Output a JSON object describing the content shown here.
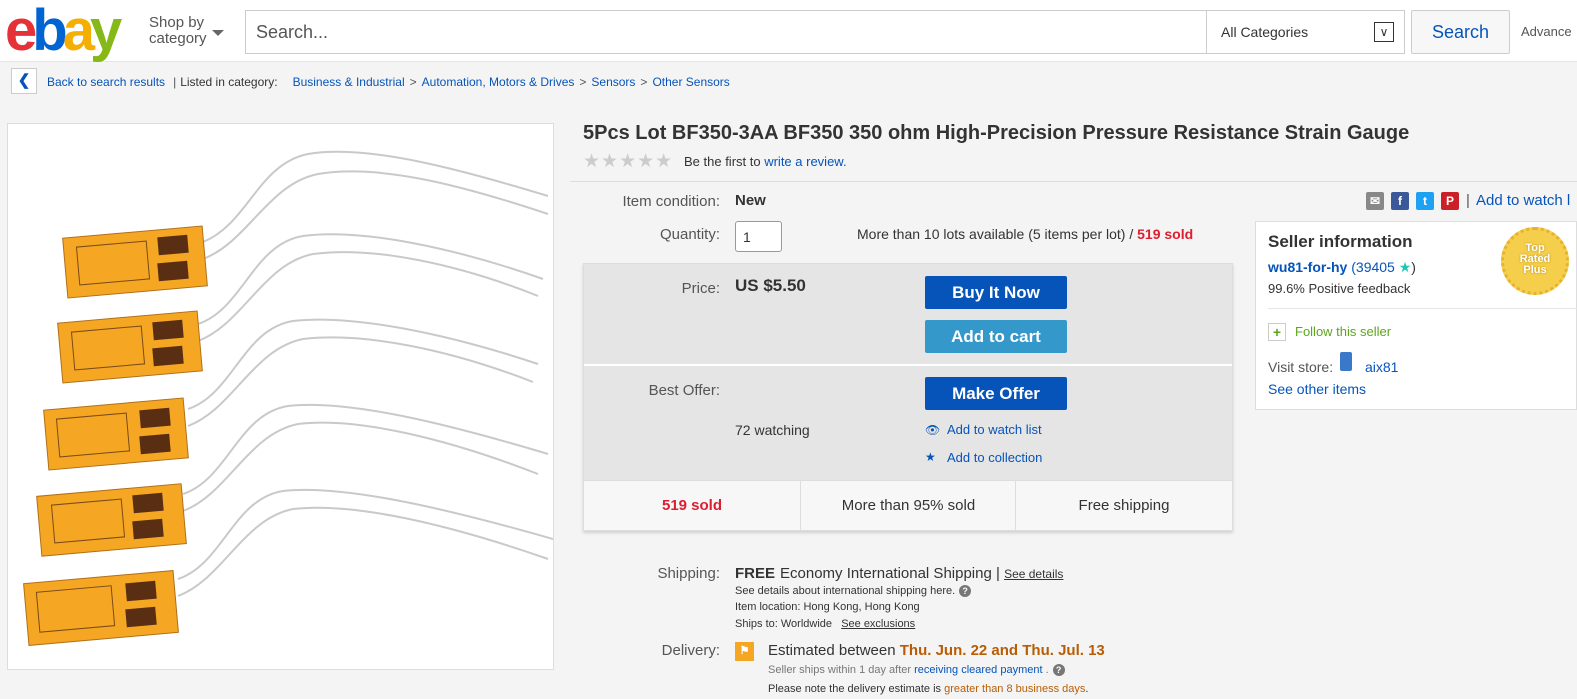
{
  "header": {
    "logo": {
      "e": "e",
      "b": "b",
      "a": "a",
      "y": "y"
    },
    "shop_by_line1": "Shop by",
    "shop_by_line2": "category",
    "search_placeholder": "Search...",
    "category_select": "All Categories",
    "search_button": "Search",
    "advanced": "Advance"
  },
  "breadcrumb": {
    "back": "Back to search results",
    "listed_in": "Listed in category:",
    "categories": [
      "Business & Industrial",
      "Automation, Motors & Drives",
      "Sensors",
      "Other Sensors"
    ],
    "separator": ">",
    "pipe": "|"
  },
  "listing": {
    "title": "5Pcs Lot BF350-3AA BF350 350 ohm High-Precision Pressure Resistance Strain Gauge",
    "stars": "★★★★★",
    "review_prefix": "Be the first to",
    "review_link": "write a review.",
    "condition_label": "Item condition:",
    "condition_value": "New",
    "quantity_label": "Quantity:",
    "quantity_value": "1",
    "availability": "More than 10 lots available (5 items per lot) /",
    "sold_count": "519 sold",
    "price_label": "Price:",
    "price_value": "US $5.50",
    "buy_now": "Buy It Now",
    "add_to_cart": "Add to cart",
    "best_offer_label": "Best Offer:",
    "make_offer": "Make Offer",
    "watching": "72 watching",
    "add_to_watch_list": "Add to watch list",
    "add_to_collection": "Add to collection",
    "stats": [
      "519 sold",
      "More than 95% sold",
      "Free shipping"
    ]
  },
  "share": {
    "icons": [
      "email-icon",
      "facebook-icon",
      "twitter-icon",
      "pinterest-icon"
    ],
    "separator": "|",
    "watch_link": "Add to watch l"
  },
  "seller": {
    "title": "Seller information",
    "name": "wu81-for-hy",
    "score_open": "(",
    "score": "39405",
    "star": "★",
    "score_close": ")",
    "feedback": "99.6% Positive feedback",
    "follow": "Follow this seller",
    "visit_store_label": "Visit store:",
    "store_name": "aix81",
    "see_other": "See other items",
    "badge_line1": "Top",
    "badge_line2": "Rated",
    "badge_line3": "Plus"
  },
  "shipping": {
    "label": "Shipping:",
    "free": "FREE",
    "method": "Economy International Shipping |",
    "see_details": "See details",
    "intl_note": "See details about international shipping here.",
    "location": "Item location:  Hong Kong, Hong Kong",
    "ships_to_prefix": "Ships to:  Worldwide",
    "see_exclusions": "See exclusions"
  },
  "delivery": {
    "label": "Delivery:",
    "estimated_prefix": "Estimated between",
    "dates": "Thu. Jun. 22 and Thu. Jul. 13",
    "ships_within": "Seller ships within 1 day after",
    "receiving": "receiving cleared payment",
    "dot": ".",
    "note_prefix": "Please note the delivery estimate is",
    "note_highlight": "greater than 8 business days",
    "note_suffix": "."
  },
  "colors": {
    "accent": "#0654ba",
    "cart": "#3498ca",
    "sold": "#dd1e31",
    "delivery": "#b85d05",
    "gauge": "#f5a623"
  }
}
